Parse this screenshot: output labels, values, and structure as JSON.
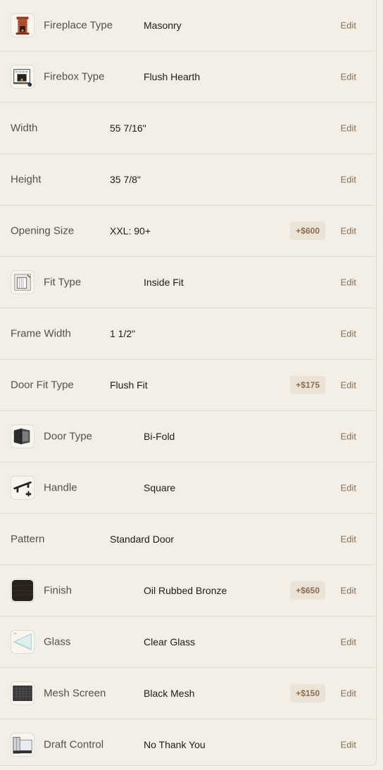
{
  "rows": [
    {
      "label": "Fireplace Type",
      "value": "Masonry",
      "price": "",
      "icon": "masonry-fireplace-icon",
      "edit": "Edit"
    },
    {
      "label": "Firebox Type",
      "value": "Flush Hearth",
      "price": "",
      "icon": "flush-hearth-icon",
      "edit": "Edit"
    },
    {
      "label": "Width",
      "value": "55 7/16\"",
      "price": "",
      "icon": "",
      "edit": "Edit"
    },
    {
      "label": "Height",
      "value": "35 7/8\"",
      "price": "",
      "icon": "",
      "edit": "Edit"
    },
    {
      "label": "Opening Size",
      "value": "XXL: 90+",
      "price": "+$600",
      "icon": "",
      "edit": "Edit"
    },
    {
      "label": "Fit Type",
      "value": "Inside Fit",
      "price": "",
      "icon": "inside-fit-icon",
      "edit": "Edit"
    },
    {
      "label": "Frame Width",
      "value": "1 1/2\"",
      "price": "",
      "icon": "",
      "edit": "Edit"
    },
    {
      "label": "Door Fit Type",
      "value": "Flush Fit",
      "price": "+$175",
      "icon": "",
      "edit": "Edit"
    },
    {
      "label": "Door Type",
      "value": "Bi-Fold",
      "price": "",
      "icon": "bi-fold-door-icon",
      "edit": "Edit"
    },
    {
      "label": "Handle",
      "value": "Square",
      "price": "",
      "icon": "handle-icon",
      "edit": "Edit"
    },
    {
      "label": "Pattern",
      "value": "Standard Door",
      "price": "",
      "icon": "",
      "edit": "Edit"
    },
    {
      "label": "Finish",
      "value": "Oil Rubbed Bronze",
      "price": "+$650",
      "icon": "bronze-finish-swatch-icon",
      "edit": "Edit"
    },
    {
      "label": "Glass",
      "value": "Clear Glass",
      "price": "",
      "icon": "clear-glass-icon",
      "edit": "Edit"
    },
    {
      "label": "Mesh Screen",
      "value": "Black Mesh",
      "price": "+$150",
      "icon": "black-mesh-icon",
      "edit": "Edit"
    },
    {
      "label": "Draft Control",
      "value": "No Thank You",
      "price": "",
      "icon": "draft-control-icon",
      "edit": "Edit"
    }
  ],
  "colors": {
    "background": "#f3eee6",
    "accent": "#8a6e52",
    "price_badge": "#ebe3d6"
  }
}
